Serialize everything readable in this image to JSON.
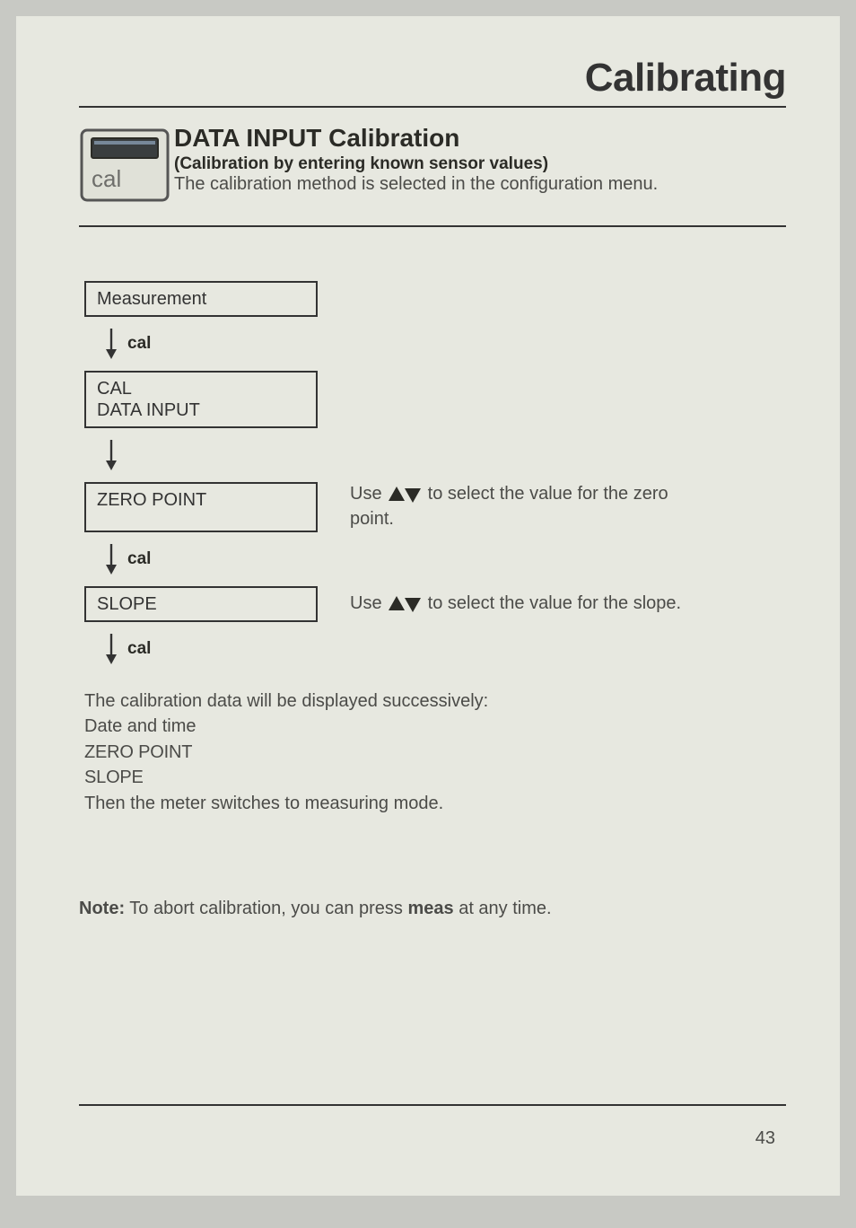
{
  "page": {
    "title": "Calibrating",
    "number": 43
  },
  "section": {
    "icon_label": "cal",
    "heading": "DATA INPUT Calibration",
    "subheading": "(Calibration by entering known sensor values)",
    "lead": "The calibration method is selected in the configuration menu."
  },
  "flow": {
    "step1": "Measurement",
    "arrow1_label": "cal",
    "step2_line1": "CAL",
    "step2_line2": "DATA INPUT",
    "step3": "ZERO POINT",
    "step3_desc_pre": "Use ",
    "step3_desc_post": " to select the value for the zero point.",
    "arrow3_label": "cal",
    "step4": "SLOPE",
    "step4_desc_pre": "Use ",
    "step4_desc_post": " to select the value for the slope.",
    "arrow4_label": "cal",
    "final_line1": "The calibration data will be displayed successively:",
    "final_line2": "Date and time",
    "final_line3": "ZERO POINT",
    "final_line4": "SLOPE",
    "final_line5": "Then the meter switches to measuring mode."
  },
  "note": {
    "prefix": "Note:",
    "middle": " To abort calibration, you can press ",
    "emph": "meas",
    "suffix": " at any time."
  }
}
